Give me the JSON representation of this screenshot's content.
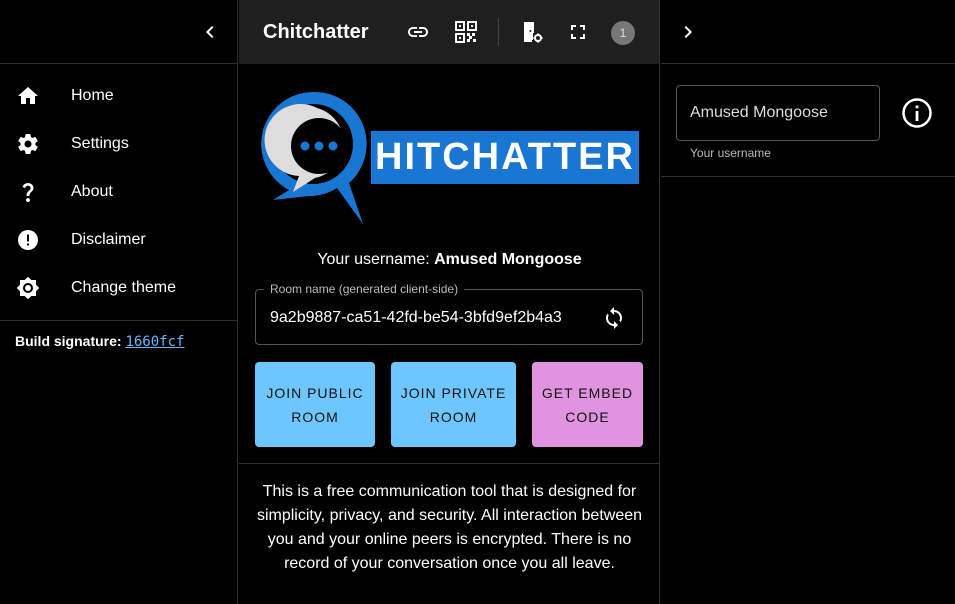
{
  "sidebar": {
    "items": [
      {
        "label": "Home",
        "icon": "home-icon"
      },
      {
        "label": "Settings",
        "icon": "gear-icon"
      },
      {
        "label": "About",
        "icon": "question-icon"
      },
      {
        "label": "Disclaimer",
        "icon": "alert-icon"
      },
      {
        "label": "Change theme",
        "icon": "brightness-icon"
      }
    ],
    "build_label": "Build signature:",
    "build_value": "1660fcf"
  },
  "header": {
    "title": "Chitchatter",
    "peer_count": "1"
  },
  "logo": {
    "text": "HITCHATTER"
  },
  "main": {
    "username_prefix": "Your username: ",
    "username": "Amused Mongoose",
    "room_label": "Room name (generated client-side)",
    "room_value": "9a2b9887-ca51-42fd-be54-3bfd9ef2b4a3",
    "join_public_label": "JOIN PUBLIC ROOM",
    "join_private_label": "JOIN PRIVATE ROOM",
    "embed_label": "GET EMBED CODE",
    "description": "This is a free communication tool that is designed for simplicity, privacy, and security. All interaction between you and your online peers is encrypted. There is no record of your conversation once you all leave."
  },
  "right_panel": {
    "username_value": "Amused Mongoose",
    "username_help": "Your username"
  },
  "colors": {
    "accent": "#1976d2",
    "primary_button": "#6ec6ff",
    "secondary_button": "#e094e0",
    "link": "#6ab7ff"
  }
}
